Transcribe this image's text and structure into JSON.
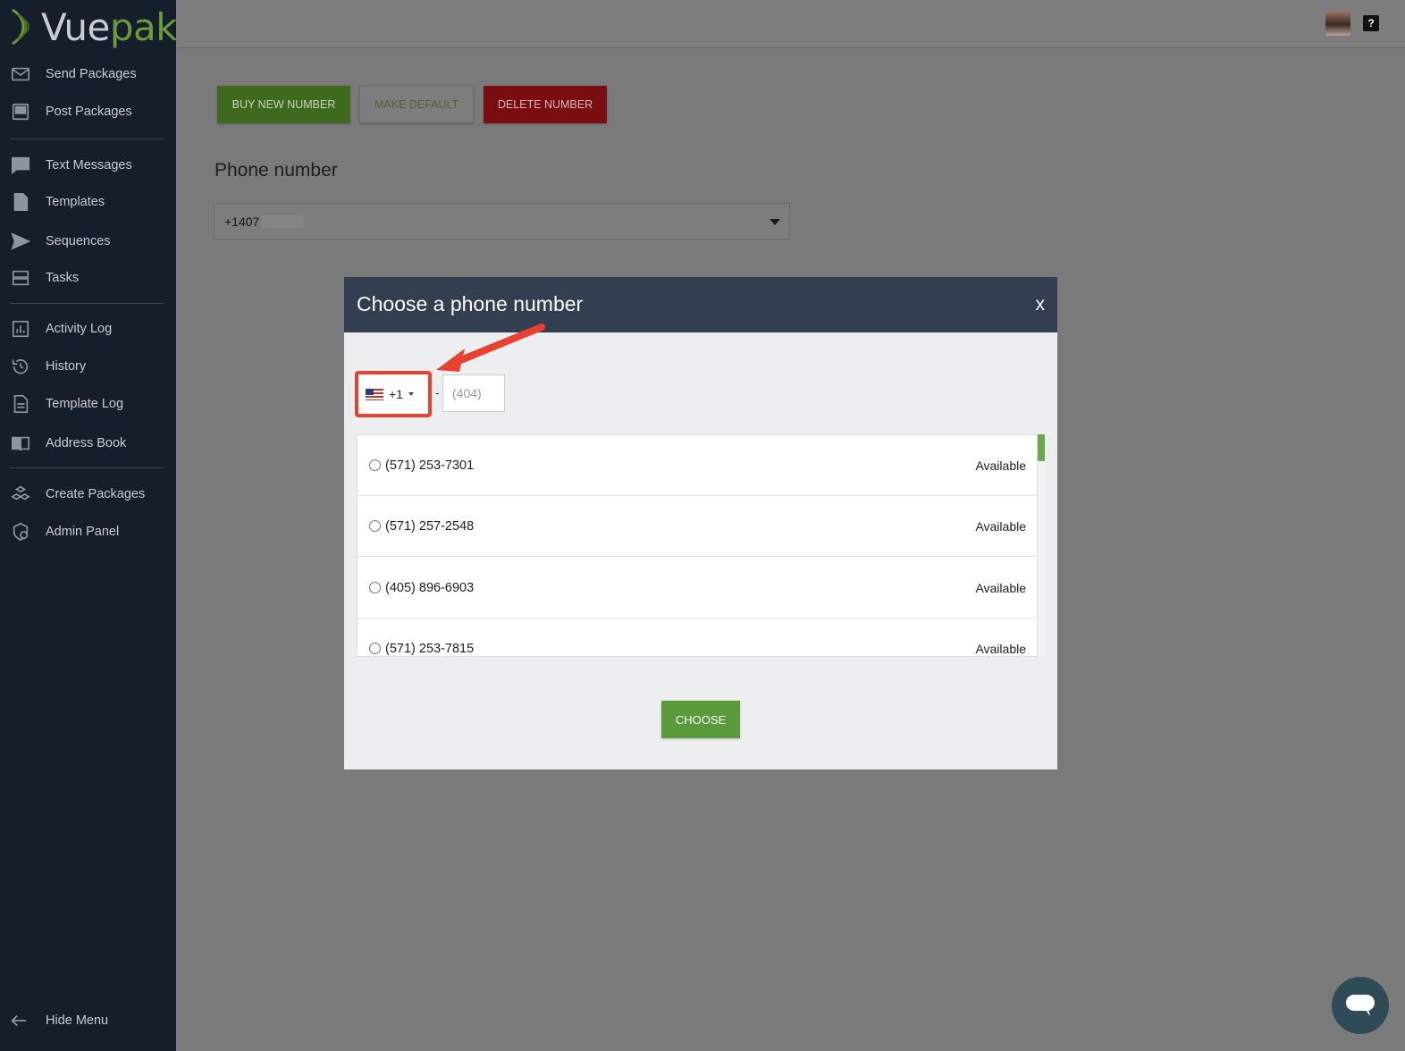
{
  "brand": {
    "logo_a": "Vue",
    "logo_b": "pak"
  },
  "sidebar": {
    "items": [
      {
        "label": "Send Packages",
        "icon": "mail-icon"
      },
      {
        "label": "Post Packages",
        "icon": "post-icon"
      },
      {
        "label": "Text Messages",
        "icon": "chat-icon"
      },
      {
        "label": "Templates",
        "icon": "document-icon"
      },
      {
        "label": "Sequences",
        "icon": "send-icon"
      },
      {
        "label": "Tasks",
        "icon": "tasks-icon"
      },
      {
        "label": "Activity Log",
        "icon": "chart-icon"
      },
      {
        "label": "History",
        "icon": "history-icon"
      },
      {
        "label": "Template Log",
        "icon": "document-log-icon"
      },
      {
        "label": "Address Book",
        "icon": "book-icon"
      },
      {
        "label": "Create Packages",
        "icon": "cubes-icon"
      },
      {
        "label": "Admin Panel",
        "icon": "admin-icon"
      }
    ],
    "hide_menu": "Hide Menu"
  },
  "toolbar": {
    "buy_label": "BUY NEW NUMBER",
    "default_label": "MAKE DEFAULT",
    "delete_label": "DELETE NUMBER"
  },
  "phone": {
    "label": "Phone number",
    "value": "+1407"
  },
  "modal": {
    "title": "Choose a phone number",
    "close": "x",
    "country_code": "+1",
    "area_placeholder": "(404)",
    "numbers": [
      {
        "number": "(571) 253-7301",
        "status": "Available"
      },
      {
        "number": "(571) 257-2548",
        "status": "Available"
      },
      {
        "number": "(405) 896-6903",
        "status": "Available"
      },
      {
        "number": "(571) 253-7815",
        "status": "Available"
      }
    ],
    "choose_label": "CHOOSE"
  },
  "colors": {
    "sidebar_bg": "#161d2b",
    "modal_header": "#333e51",
    "accent_green": "#5a9a3a",
    "danger": "#7a0d10",
    "highlight": "#e8412f"
  }
}
